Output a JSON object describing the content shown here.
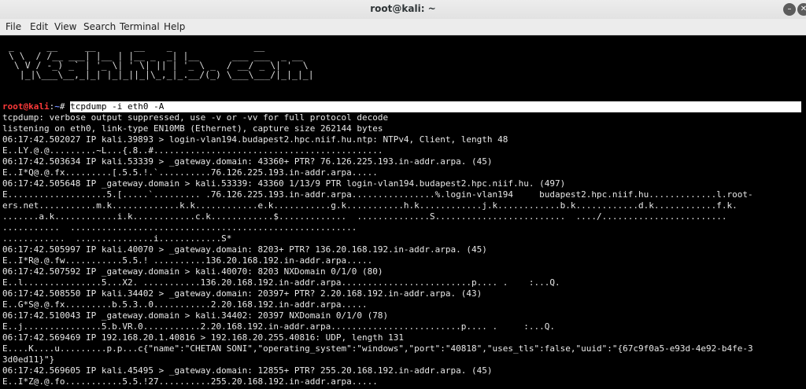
{
  "window": {
    "title": "root@kali: ~",
    "minimize_glyph": "–",
    "close_glyph": "✕"
  },
  "menu": {
    "items": [
      "File",
      "Edit",
      "View",
      "Search",
      "Terminal",
      "Help"
    ]
  },
  "banner": {
    "art": " _      __     __       __    _               __\n \\ \\  / /__ ___| |__ | |__ _  _| |__      ___ ___  _ __\n  \\ V / -_) _` | '_ \\| ' \\| || | '_ \\ _  / __/ _ \\| '  \\\n   |_|\\___\\__,_|_| |_|_||_|\\_,_|_.__/(_) \\___\\___/|_|_|_|",
    "colors": {
      "text": "#d8d8d8"
    }
  },
  "prompt": {
    "user": "root@kali",
    "colon": ":",
    "path": "~",
    "hash": "# ",
    "command": "tcpdump -i eth0 -A",
    "colors": {
      "user": "#ff3a3a",
      "path": "#6f8cff",
      "highlight_bg": "#ffffff"
    }
  },
  "output": [
    "tcpdump: verbose output suppressed, use -v or -vv for full protocol decode",
    "listening on eth0, link-type EN10MB (Ethernet), capture size 262144 bytes",
    "06:17:42.502027 IP kali.39893 > login-vlan194.budapest2.hpc.niif.hu.ntp: NTPv4, Client, length 48",
    "E..LY.@.@.........~L...{.8..#............................................",
    "06:17:42.503634 IP kali.53339 > _gateway.domain: 43360+ PTR? 76.126.225.193.in-addr.arpa. (45)",
    "E..I*Q@.@.fx.........[.5.5.!.`..........76.126.225.193.in-addr.arpa.....",
    "06:17:42.505648 IP _gateway.domain > kali.53339: 43360 1/13/9 PTR login-vlan194.budapest2.hpc.niif.hu. (497)",
    "E...................5.[.....`......... .76.126.225.193.in-addr.arpa................%.login-vlan194     budapest2.hpc.niif.hu.............l.root-",
    "ers.net...........m.k.............k.k............e.k...........g.k...........h.k............j.k............b.k............d.k............f.k.",
    ".......a.k............i.k............c.k............$.............  ..............S.........................  ..../........................",
    "...........  .......................................................",
    "............  ...............i............S*",
    "06:17:42.505997 IP kali.40070 > _gateway.domain: 8203+ PTR? 136.20.168.192.in-addr.arpa. (45)",
    "E..I*R@.@.fw...........5.5.! ..........136.20.168.192.in-addr.arpa.....",
    "06:17:42.507592 IP _gateway.domain > kali.40070: 8203 NXDomain 0/1/0 (80)",
    "E..l...............5...X2. ...........136.20.168.192.in-addr.arpa.........................p.... .    :...Q.",
    "06:17:42.508550 IP kali.34402 > _gateway.domain: 20397+ PTR? 2.20.168.192.in-addr.arpa. (43)",
    "E..G*S@.@.fx.........b.5.3..0...........2.20.168.192.in-addr.arpa.....",
    "06:17:42.510043 IP _gateway.domain > kali.34402: 20397 NXDomain 0/1/0 (78)",
    "E..j...............5.b.VR.0...........2.20.168.192.in-addr.arpa.........................p.... .     :...Q.",
    "06:17:42.569469 IP 192.168.20.1.40816 > 192.168.20.255.40816: UDP, length 131",
    "E....K....u.........p.p...c{\"name\":\"CHETAN SONI\",\"operating_system\":\"windows\",\"port\":\"40818\",\"uses_tls\":false,\"uuid\":\"{67c9f0a5-e93d-4e92-b4fe-3",
    "3d0ed11}\"}",
    "06:17:42.569605 IP kali.45495 > _gateway.domain: 12855+ PTR? 255.20.168.192.in-addr.arpa. (45)",
    "E..I*Z@.@.fo...........5.5.!27..........255.20.168.192.in-addr.arpa....."
  ]
}
